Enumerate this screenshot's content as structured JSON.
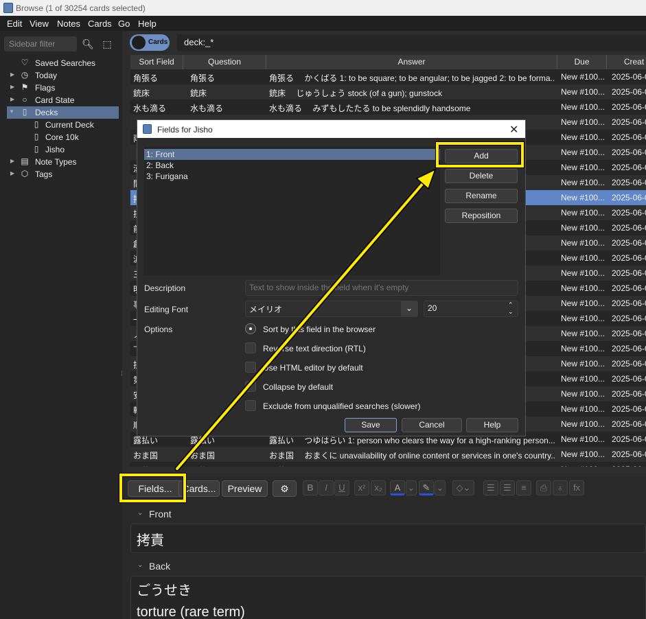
{
  "window": {
    "title": "Browse (1 of 30254 cards selected)"
  },
  "menu": [
    "Edit",
    "View",
    "Notes",
    "Cards",
    "Go",
    "Help"
  ],
  "sidebar": {
    "filter_placeholder": "Sidebar filter",
    "items": [
      {
        "label": "Saved Searches",
        "icon": "heart-icon"
      },
      {
        "label": "Today",
        "icon": "clock-icon"
      },
      {
        "label": "Flags",
        "icon": "flag-icon"
      },
      {
        "label": "Card State",
        "icon": "circle-icon"
      },
      {
        "label": "Decks",
        "icon": "deck-icon"
      },
      {
        "label": "Current Deck",
        "icon": "deck-icon"
      },
      {
        "label": "Core 10k",
        "icon": "deck-icon"
      },
      {
        "label": "Jisho",
        "icon": "deck-icon"
      },
      {
        "label": "Note Types",
        "icon": "note-types-icon"
      },
      {
        "label": "Tags",
        "icon": "tag-icon"
      }
    ]
  },
  "search": {
    "toggle_label": "Cards",
    "query": "deck:_*"
  },
  "table": {
    "columns": [
      "Sort Field",
      "Question",
      "Answer",
      "Due",
      "Creat"
    ],
    "rows": [
      {
        "sort": "角張る",
        "q": "角張る",
        "a": "角張る　 かくばる 1: to be square; to be angular; to be jagged 2: to be forma...",
        "due": "New #100...",
        "created": "2025-06-0"
      },
      {
        "sort": "銃床",
        "q": "銃床",
        "a": "銃床　 じゅうしょう stock (of a gun); gunstock",
        "due": "New #100...",
        "created": "2025-06-0"
      },
      {
        "sort": "水も滴る",
        "q": "水も滴る",
        "a": "水も滴る　 みずもしたたる to be splendidly handsome",
        "due": "New #100...",
        "created": "2025-06-0"
      },
      {
        "sort": "",
        "q": "",
        "a": "",
        "due": "New #100...",
        "created": "2025-06-0"
      },
      {
        "sort": "両",
        "q": "",
        "a": "",
        "due": "New #100...",
        "created": "2025-06-0"
      },
      {
        "sort": "",
        "q": "",
        "a": "",
        "due": "New #100...",
        "created": "2025-06-0"
      },
      {
        "sort": "漢",
        "q": "",
        "a": "ns (b...",
        "due": "New #100...",
        "created": "2025-06-0"
      },
      {
        "sort": "間",
        "q": "",
        "a": "",
        "due": "New #100...",
        "created": "2025-06-0"
      },
      {
        "sort": "拷",
        "q": "",
        "a": "",
        "due": "New #100...",
        "created": "2025-06-0"
      },
      {
        "sort": "扶",
        "q": "",
        "a": "uth, ...",
        "due": "New #100...",
        "created": "2025-06-0"
      },
      {
        "sort": "前",
        "q": "",
        "a": "gonou...",
        "due": "New #100...",
        "created": "2025-06-0"
      },
      {
        "sort": "創",
        "q": "",
        "a": "",
        "due": "New #100...",
        "created": "2025-06-0"
      },
      {
        "sort": "派",
        "q": "",
        "a": "",
        "due": "New #100...",
        "created": "2025-06-0"
      },
      {
        "sort": "三",
        "q": "",
        "a": "abuki...",
        "due": "New #100...",
        "created": "2025-06-0"
      },
      {
        "sort": "明",
        "q": "",
        "a": "",
        "due": "New #100...",
        "created": "2025-06-0"
      },
      {
        "sort": "事",
        "q": "",
        "a": "",
        "due": "New #100...",
        "created": "2025-06-0"
      },
      {
        "sort": "一",
        "q": "",
        "a": "track ...",
        "due": "New #100...",
        "created": "2025-06-0"
      },
      {
        "sort": "ノ",
        "q": "",
        "a": "ics(m...",
        "due": "New #100...",
        "created": "2025-06-0"
      },
      {
        "sort": "下",
        "q": "",
        "a": "late, e...",
        "due": "New #100...",
        "created": "2025-06-0"
      },
      {
        "sort": "扶",
        "q": "",
        "a": "dly act...",
        "due": "New #100...",
        "created": "2025-06-0"
      },
      {
        "sort": "第",
        "q": "",
        "a": "",
        "due": "New #100...",
        "created": "2025-06-0"
      },
      {
        "sort": "安",
        "q": "",
        "a": "",
        "due": "New #100...",
        "created": "2025-06-0"
      },
      {
        "sort": "輔",
        "q": "",
        "a": "",
        "due": "New #100...",
        "created": "2025-06-0"
      },
      {
        "sort": "順",
        "q": "",
        "a": "",
        "due": "New #100...",
        "created": "2025-06-0"
      },
      {
        "sort": "露払い",
        "q": "露払い",
        "a": "露払い　 つゆはらい 1: person who clears the way for a high-ranking person...",
        "due": "New #100...",
        "created": "2025-06-0"
      },
      {
        "sort": "おま国",
        "q": "おま国",
        "a": "おま国　 おまくに unavailability of online content or services in one's country...",
        "due": "New #100...",
        "created": "2025-06-0"
      },
      {
        "sort": "愚蒙",
        "q": "愚蒙",
        "a": "愚蒙　 ぐもう stupid; foolish",
        "due": "New #100...",
        "created": "2025-06-0"
      }
    ]
  },
  "editor": {
    "buttons": {
      "fields": "Fields...",
      "cards": "Cards...",
      "preview": "Preview"
    },
    "fields": [
      {
        "name": "Front",
        "value": "拷責"
      },
      {
        "name": "Back",
        "value_lines": [
          "ごうせき",
          "torture (rare term)"
        ]
      }
    ]
  },
  "dialog": {
    "title": "Fields for Jisho",
    "fields": [
      "1: Front",
      "2: Back",
      "3: Furigana"
    ],
    "buttons": {
      "add": "Add",
      "delete": "Delete",
      "rename": "Rename",
      "reposition": "Reposition",
      "save": "Save",
      "cancel": "Cancel",
      "help": "Help"
    },
    "description_label": "Description",
    "description_placeholder": "Text to show inside the field when it's empty",
    "font_label": "Editing Font",
    "font_value": "メイリオ",
    "font_size": "20",
    "options_label": "Options",
    "options": [
      {
        "label": "Sort by this field in the browser",
        "type": "radio",
        "checked": true
      },
      {
        "label": "Reverse text direction (RTL)",
        "type": "checkbox"
      },
      {
        "label": "Use HTML editor by default",
        "type": "checkbox"
      },
      {
        "label": "Collapse by default",
        "type": "checkbox"
      },
      {
        "label": "Exclude from unqualified searches (slower)",
        "type": "checkbox"
      }
    ]
  },
  "highlight_color": "#ffea00"
}
